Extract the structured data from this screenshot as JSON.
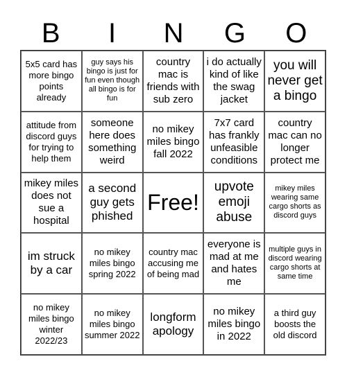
{
  "header": {
    "letters": [
      "B",
      "I",
      "N",
      "G",
      "O"
    ]
  },
  "cells": [
    "5x5 card has more bingo points already",
    "guy says his bingo is just for fun even though all bingo is for fun",
    "country mac is friends with sub zero",
    "i do actually kind of like the swag jacket",
    "you will never get a bingo",
    "attitude from discord guys for trying to help them",
    "someone here does something weird",
    "no mikey miles bingo fall 2022",
    "7x7 card has frankly unfeasible conditions",
    "country mac can no longer protect me",
    "mikey miles does not sue a hospital",
    "a second guy gets phished",
    "Free!",
    "upvote emoji abuse",
    "mikey miles wearing same cargo shorts as discord guys",
    "im struck by a car",
    "no mikey miles bingo spring 2022",
    "country mac accusing me of being mad",
    "everyone is mad at me and hates me",
    "multiple guys in discord wearing cargo shorts at same time",
    "no mikey miles bingo winter 2022/23",
    "no mikey miles bingo summer 2022",
    "longform apology",
    "no mikey miles bingo in 2022",
    "a third guy boosts the old discord"
  ]
}
